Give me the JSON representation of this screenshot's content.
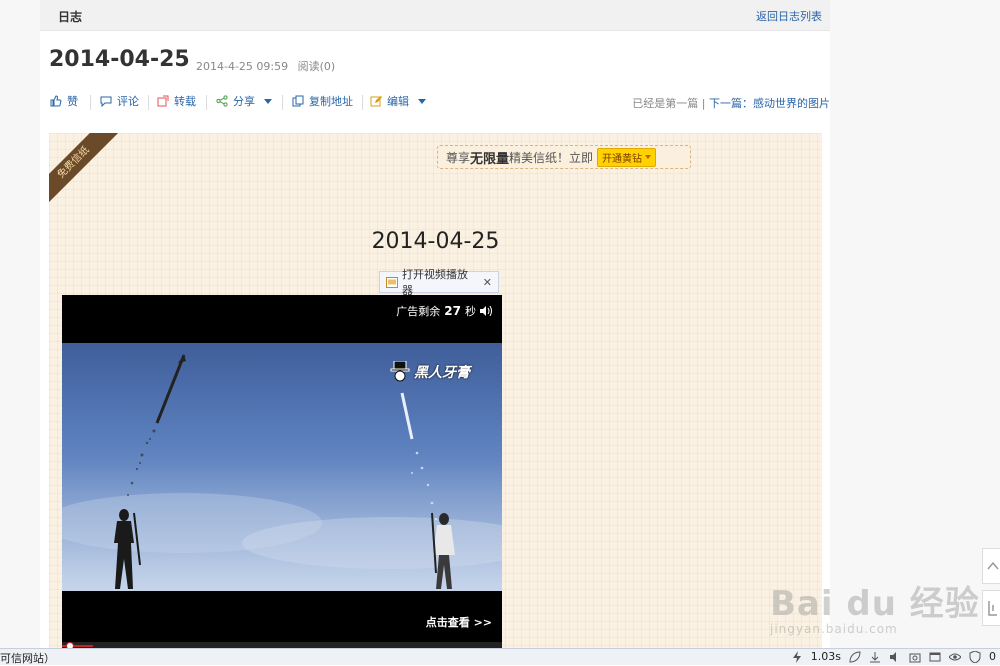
{
  "header": {
    "title": "日志",
    "back_link": "返回日志列表"
  },
  "post": {
    "title": "2014-04-25",
    "date": "2014-4-25 09:59",
    "reads": "阅读(0)"
  },
  "actions": {
    "like": "赞",
    "comment": "评论",
    "repost": "转载",
    "share": "分享",
    "copy_link": "复制地址",
    "edit": "编辑"
  },
  "navigation": {
    "prev_text": "已经是第一篇",
    "separator": "|",
    "next_text": "下一篇：感动世界的图片"
  },
  "letter": {
    "ribbon": "免费信纸",
    "promo_prefix": "尊享",
    "promo_bold": "无限量",
    "promo_suffix": "精美信纸！立即",
    "promo_button": "开通黄钻",
    "heading": "2014-04-25"
  },
  "video": {
    "open_player": "打开视频播放器",
    "ad_prefix": "广告剩余",
    "ad_seconds": "27",
    "ad_suffix": "秒",
    "logo_text": "黑人牙膏",
    "click_view": "点击查看 >>",
    "progress_fraction": 0.07
  },
  "statusbar": {
    "left_text": "可信网站）",
    "speed": "1.03s",
    "count": "0"
  },
  "watermark": {
    "main": "Bai du 经验",
    "sub": "jingyan.baidu.com"
  },
  "colors": {
    "link": "#2a65a8",
    "letter_bg": "#fbf1e2",
    "vip": "#ffd200"
  }
}
